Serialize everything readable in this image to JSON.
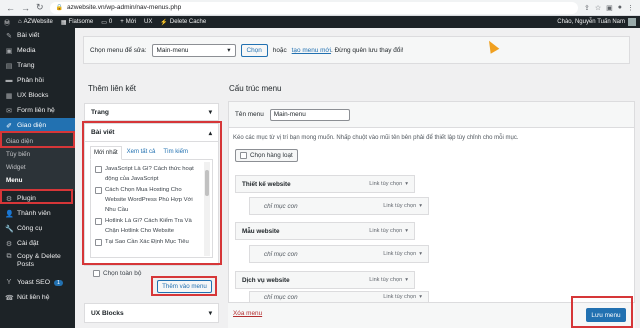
{
  "browser": {
    "url": "azwebsite.vn/wp-admin/nav-menus.php",
    "back_icon": "arrow-left-icon",
    "forward_icon": "arrow-right-icon",
    "reload_icon": "reload-icon"
  },
  "adminbar": {
    "site_name": "AZWebsite",
    "theme_name": "Flatsome",
    "comments_count": "0",
    "new_label": "Mới",
    "ux_builder": "UX",
    "delete_cache": "Delete Cache",
    "greeting": "Chào, Nguyễn Tuấn Nam"
  },
  "sidebar": {
    "items": [
      {
        "label": "Bài viết",
        "icon": "pin-icon"
      },
      {
        "label": "Media",
        "icon": "media-icon"
      },
      {
        "label": "Trang",
        "icon": "page-icon"
      },
      {
        "label": "Phản hồi",
        "icon": "comment-icon"
      },
      {
        "label": "UX Blocks",
        "icon": "blocks-icon"
      },
      {
        "label": "Form liên hệ",
        "icon": "mail-icon"
      },
      {
        "label": "Giao diện",
        "icon": "brush-icon"
      }
    ],
    "submenu": [
      "Giao diện",
      "Tùy biến",
      "Widget",
      "Menu"
    ],
    "items_after": [
      {
        "label": "Plugin",
        "icon": "plugin-icon"
      },
      {
        "label": "Thành viên",
        "icon": "user-icon"
      },
      {
        "label": "Công cụ",
        "icon": "tool-icon"
      },
      {
        "label": "Cài đặt",
        "icon": "settings-icon"
      },
      {
        "label": "Copy & Delete Posts",
        "icon": "copy-icon"
      },
      {
        "label": "Yoast SEO",
        "icon": "yoast-icon",
        "badge": "1"
      },
      {
        "label": "Nút liên hệ",
        "icon": "phone-icon"
      }
    ]
  },
  "select_bar": {
    "label": "Chọn menu để sửa:",
    "selected": "Main-menu",
    "button": "Chọn",
    "or_text": "hoặc",
    "create_link": "tạo menu mới",
    "tail_text": ". Đừng quên lưu thay đổi!"
  },
  "left_col": {
    "heading": "Thêm liên kết",
    "pages_label": "Trang",
    "posts_label": "Bài viết",
    "tabs": [
      "Mới nhất",
      "Xem tất cả",
      "Tìm kiếm"
    ],
    "posts": [
      "JavaScript Là Gì? Cách thức hoạt động của JavaScript",
      "Cách Chọn Mua Hosting Cho Website WordPress Phù Hợp Với Nhu Cầu",
      "Hotlink Là Gì? Cách Kiểm Tra Và Chặn Hotlink Cho Website",
      "Tại Sao Cần Xác Định Mục Tiêu"
    ],
    "select_all": "Chọn toàn bộ",
    "add_button": "Thêm vào menu",
    "ux_blocks_label": "UX Blocks"
  },
  "right_col": {
    "heading": "Cấu trúc menu",
    "name_label": "Tên menu",
    "name_value": "Main-menu",
    "instructions": "Kéo các mục từ vị trí bạn mong muốn. Nhấp chuột vào mũi tên bên phải để thiết lập tùy chỉnh cho mỗi mục.",
    "bulk_select": "Chọn hàng loạt",
    "items": [
      {
        "title": "Thiết kế website",
        "type": "Link tùy chọn",
        "sub": false
      },
      {
        "title": "chỉ mục con",
        "type": "Link tùy chọn",
        "sub": true
      },
      {
        "title": "Mẫu website",
        "type": "Link tùy chọn",
        "sub": false
      },
      {
        "title": "chỉ mục con",
        "type": "Link tùy chọn",
        "sub": true
      },
      {
        "title": "Dịch vụ website",
        "type": "Link tùy chọn",
        "sub": false
      },
      {
        "title": "chỉ mục con",
        "type": "Link tùy chọn",
        "sub": true
      }
    ],
    "delete_link": "Xóa menu",
    "save_button": "Lưu menu"
  },
  "colors": {
    "accent": "#2271b1",
    "sidebar_bg": "#1d2327",
    "highlight": "#d63638"
  }
}
